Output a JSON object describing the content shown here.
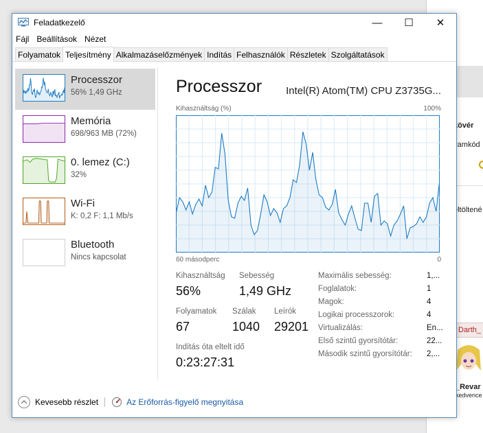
{
  "background": {
    "rows": [
      "kövér",
      "ramkód",
      "eltöltené",
      "Darth_",
      "_Revar",
      "kedvence"
    ]
  },
  "window": {
    "title": "Feladatkezelő",
    "controls": {
      "minimize": "—",
      "maximize": "☐",
      "close": "✕"
    }
  },
  "menu": [
    "Fájl",
    "Beállítások",
    "Nézet"
  ],
  "tabs": [
    {
      "label": "Folyamatok",
      "active": false
    },
    {
      "label": "Teljesítmény",
      "active": true
    },
    {
      "label": "Alkalmazáselőzmények",
      "active": false
    },
    {
      "label": "Indítás",
      "active": false
    },
    {
      "label": "Felhasználók",
      "active": false
    },
    {
      "label": "Részletek",
      "active": false
    },
    {
      "label": "Szolgáltatások",
      "active": false
    }
  ],
  "sidebar": [
    {
      "title": "Processzor",
      "sub": "56%  1,49 GHz",
      "color": "#1c7cc4",
      "active": true
    },
    {
      "title": "Memória",
      "sub": "698/963 MB (72%)",
      "color": "#8b2aa6",
      "active": false
    },
    {
      "title": "0. lemez (C:)",
      "sub": "32%",
      "color": "#4ca523",
      "active": false
    },
    {
      "title": "Wi-Fi",
      "sub": "K: 0,2  F: 1,1 Mb/s",
      "color": "#b35a14",
      "active": false
    },
    {
      "title": "Bluetooth",
      "sub": "Nincs kapcsolat",
      "color": "#cfcfcf",
      "active": false
    }
  ],
  "main": {
    "title": "Processzor",
    "cpu_name": "Intel(R) Atom(TM) CPU Z3735G...",
    "graph_label_left": "Kihasználtság (%)",
    "graph_label_right": "100%",
    "axis_left": "60 másodperc",
    "axis_right": "0",
    "stats": {
      "utilization_label": "Kihasználtság",
      "utilization_value": "56%",
      "speed_label": "Sebesség",
      "speed_value": "1,49 GHz",
      "processes_label": "Folyamatok",
      "processes_value": "67",
      "threads_label": "Szálak",
      "threads_value": "1040",
      "handles_label": "Leírók",
      "handles_value": "29201",
      "uptime_label": "Indítás óta eltelt idő",
      "uptime_value": "0:23:27:31"
    },
    "specs": [
      {
        "label": "Maximális sebesség:",
        "value": "1,..."
      },
      {
        "label": "Foglalatok:",
        "value": "1"
      },
      {
        "label": "Magok:",
        "value": "4"
      },
      {
        "label": "Logikai processzorok:",
        "value": "4"
      },
      {
        "label": "Virtualizálás:",
        "value": "En..."
      },
      {
        "label": "Első szintű gyorsítótár:",
        "value": "22..."
      },
      {
        "label": "Második szintű gyorsítótár:",
        "value": "2,..."
      }
    ]
  },
  "footer": {
    "fewer_details": "Kevesebb részlet",
    "resource_monitor": "Az Erőforrás-figyelő megnyitása"
  },
  "chart_data": {
    "type": "area",
    "ylabel": "Kihasználtság (%)",
    "ylim": [
      0,
      100
    ],
    "xlim": [
      60,
      0
    ],
    "x_label_left": "60 másodperc",
    "x_label_right": "0",
    "grid": true,
    "color": "#1c7cc4",
    "values": [
      29,
      40,
      37,
      31,
      37,
      28,
      35,
      39,
      34,
      49,
      40,
      44,
      62,
      61,
      87,
      72,
      38,
      26,
      25,
      36,
      41,
      38,
      47,
      20,
      13,
      16,
      28,
      42,
      37,
      27,
      32,
      29,
      22,
      32,
      34,
      40,
      53,
      51,
      64,
      88,
      79,
      60,
      73,
      53,
      42,
      40,
      33,
      31,
      35,
      46,
      29,
      24,
      20,
      28,
      34,
      25,
      17,
      16,
      36,
      36,
      22,
      41,
      43,
      20,
      23,
      21,
      12,
      20,
      23,
      28,
      34,
      10,
      18,
      19,
      21,
      26,
      22,
      26,
      36,
      40,
      30,
      51
    ]
  }
}
